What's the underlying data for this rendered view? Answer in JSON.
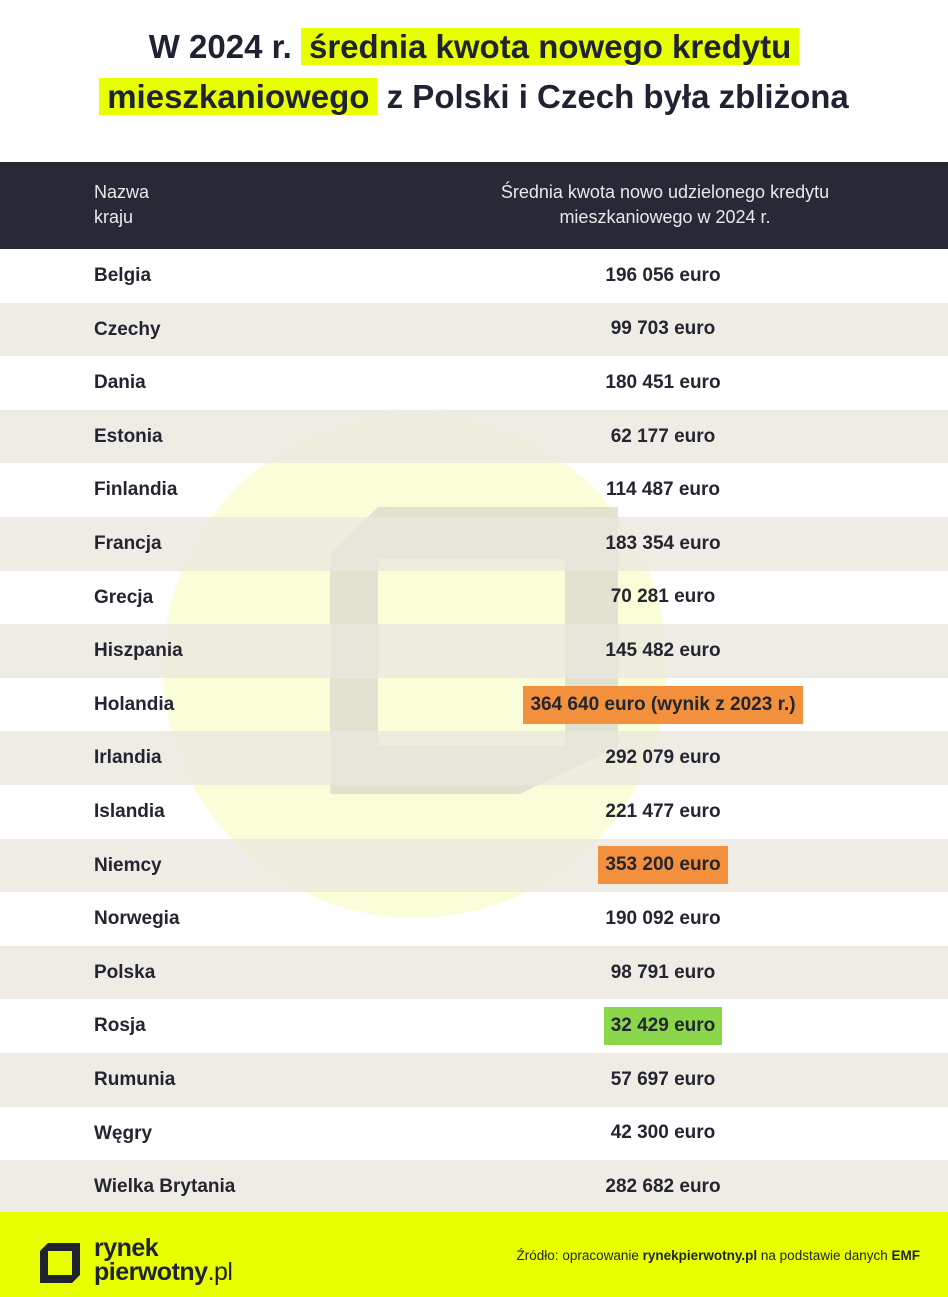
{
  "title": {
    "part1": "W 2024 r.",
    "highlight1": "średnia kwota nowego kredytu",
    "highlight2": "mieszkaniowego",
    "part2": "z Polski i Czech była zbliżona"
  },
  "table": {
    "header_country": "Nazwa kraju",
    "header_amount": "Średnia kwota nowo udzielonego kredytu mieszkaniowego w 2024 r.",
    "rows": [
      {
        "country": "Belgia",
        "amount": "196 056 euro",
        "highlight": "none"
      },
      {
        "country": "Czechy",
        "amount": "99 703 euro",
        "highlight": "none"
      },
      {
        "country": "Dania",
        "amount": "180 451 euro",
        "highlight": "none"
      },
      {
        "country": "Estonia",
        "amount": "62 177 euro",
        "highlight": "none"
      },
      {
        "country": "Finlandia",
        "amount": "114 487 euro",
        "highlight": "none"
      },
      {
        "country": "Francja",
        "amount": "183 354 euro",
        "highlight": "none"
      },
      {
        "country": "Grecja",
        "amount": "70 281 euro",
        "highlight": "none"
      },
      {
        "country": "Hiszpania",
        "amount": "145 482 euro",
        "highlight": "none"
      },
      {
        "country": "Holandia",
        "amount": "364 640 euro (wynik z 2023 r.)",
        "highlight": "orange"
      },
      {
        "country": "Irlandia",
        "amount": "292 079 euro",
        "highlight": "none"
      },
      {
        "country": "Islandia",
        "amount": "221 477 euro",
        "highlight": "none"
      },
      {
        "country": "Niemcy",
        "amount": "353 200 euro",
        "highlight": "orange"
      },
      {
        "country": "Norwegia",
        "amount": "190 092 euro",
        "highlight": "none"
      },
      {
        "country": "Polska",
        "amount": "98 791 euro",
        "highlight": "none"
      },
      {
        "country": "Rosja",
        "amount": "32 429 euro",
        "highlight": "green"
      },
      {
        "country": "Rumunia",
        "amount": "57 697 euro",
        "highlight": "none"
      },
      {
        "country": "Węgry",
        "amount": "42 300 euro",
        "highlight": "none"
      },
      {
        "country": "Wielka Brytania",
        "amount": "282 682 euro",
        "highlight": "none"
      }
    ]
  },
  "footer": {
    "logo_line1": "rynek",
    "logo_line2": "pierwotny",
    "logo_suffix": ".pl",
    "source_prefix": "Źródło: opracowanie ",
    "source_site": "rynekpierwotny.pl",
    "source_middle": " na podstawie danych ",
    "source_org": "EMF"
  },
  "colors": {
    "accent": "#e8ff00",
    "header_bg": "#272a36",
    "orange_highlight": "#f2903e",
    "green_highlight": "#8bd64a"
  }
}
